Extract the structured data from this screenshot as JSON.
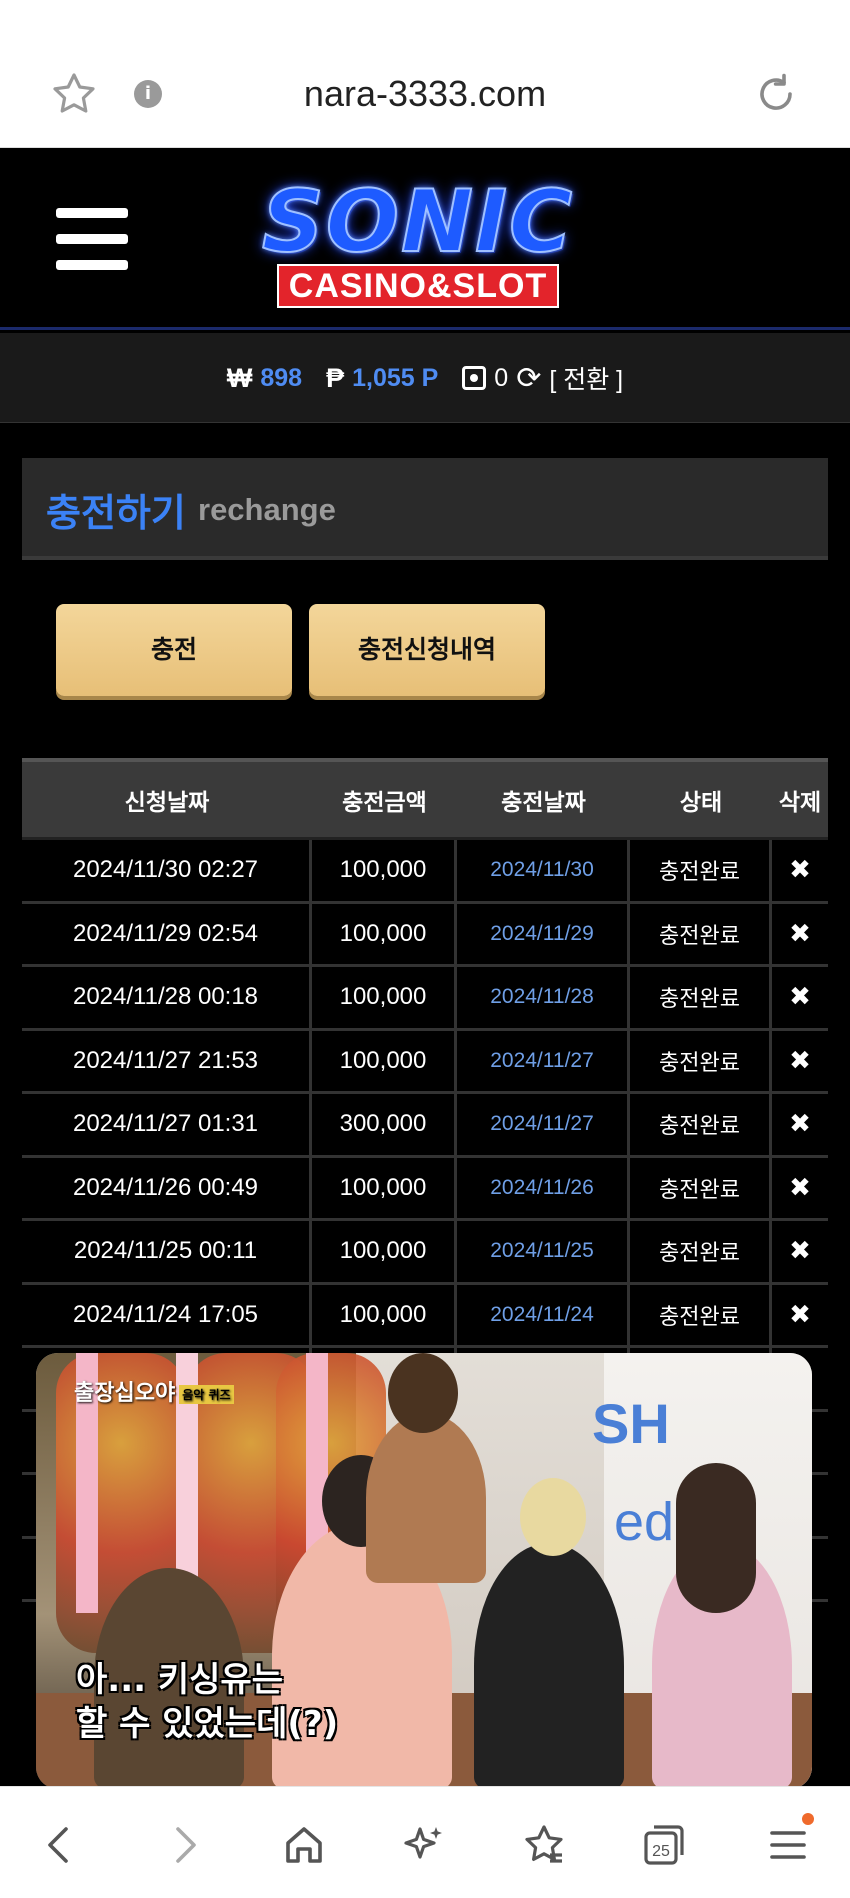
{
  "browser": {
    "url": "nara-3333.com",
    "icons": [
      "star-icon",
      "info-icon",
      "reload-icon"
    ]
  },
  "site": {
    "logo_main": "SONIC",
    "logo_sub": "CASINO&SLOT"
  },
  "balance": {
    "won_symbol": "₩",
    "won_value": "898",
    "point_symbol": "₱",
    "point_value": "1,055 P",
    "chip_value": "0",
    "convert_label": "[ 전환 ]"
  },
  "section": {
    "title": "충전하기",
    "subtitle": "rechange"
  },
  "buttons": {
    "charge": "충전",
    "history": "충전신청내역"
  },
  "table": {
    "headers": [
      "신청날짜",
      "충전금액",
      "충전날짜",
      "상태",
      "삭제"
    ],
    "rows": [
      {
        "request": "2024/11/30 02:27",
        "amount": "100,000",
        "charged": "2024/11/30",
        "status": "충전완료"
      },
      {
        "request": "2024/11/29 02:54",
        "amount": "100,000",
        "charged": "2024/11/29",
        "status": "충전완료"
      },
      {
        "request": "2024/11/28 00:18",
        "amount": "100,000",
        "charged": "2024/11/28",
        "status": "충전완료"
      },
      {
        "request": "2024/11/27 21:53",
        "amount": "100,000",
        "charged": "2024/11/27",
        "status": "충전완료"
      },
      {
        "request": "2024/11/27 01:31",
        "amount": "300,000",
        "charged": "2024/11/27",
        "status": "충전완료"
      },
      {
        "request": "2024/11/26 00:49",
        "amount": "100,000",
        "charged": "2024/11/26",
        "status": "충전완료"
      },
      {
        "request": "2024/11/25 00:11",
        "amount": "100,000",
        "charged": "2024/11/25",
        "status": "충전완료"
      },
      {
        "request": "2024/11/24 17:05",
        "amount": "100,000",
        "charged": "2024/11/24",
        "status": "충전완료"
      }
    ],
    "delete_symbol": "✖"
  },
  "video": {
    "channel_logo": "출장십오야",
    "channel_tag": "음악 퀴즈",
    "caption_line1": "아... 키싱유는",
    "caption_line2": "할 수 있었는데(?)",
    "sign_text1": "SH",
    "sign_text2": "ed"
  },
  "bottom_nav": {
    "tab_count": "25"
  }
}
